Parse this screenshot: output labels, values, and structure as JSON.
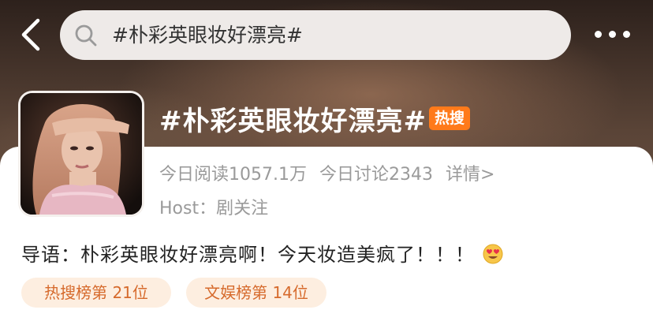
{
  "search": {
    "query": "#朴彩英眼妆好漂亮#"
  },
  "topic": {
    "title": "#朴彩英眼妆好漂亮#",
    "badge": "热搜",
    "reads": "今日阅读1057.1万",
    "discussions": "今日讨论2343",
    "details_link": "详情>",
    "host": "Host：剧关注",
    "intro": "导语：朴彩英眼妆好漂亮啊！今天妆造美疯了！！！"
  },
  "rank_chips": [
    {
      "label": "热搜榜第 21位"
    },
    {
      "label": "文娱榜第 14位"
    }
  ],
  "icons": {
    "back": "chevron-left-icon",
    "search": "search-icon",
    "more": "more-horizontal-icon",
    "emoji": "heart-eyes-emoji-icon"
  },
  "colors": {
    "hot_badge": "#ff7a1a",
    "chip_bg": "#fdeee0",
    "chip_text": "#d66a2c"
  }
}
